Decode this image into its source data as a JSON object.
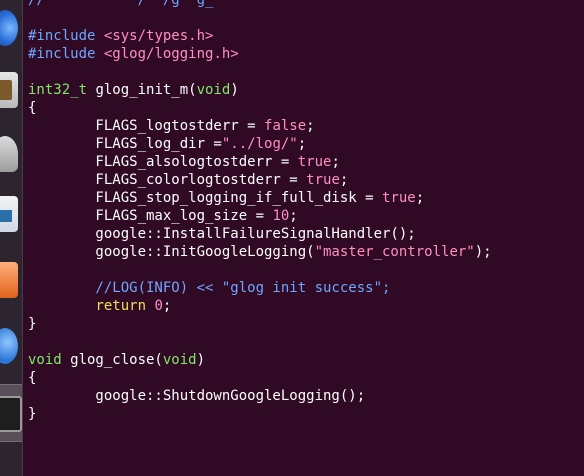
{
  "editor": {
    "lines": [
      [
        {
          "t": "// ",
          "c": "cm"
        },
        {
          "t": "          /  /g  g_",
          "c": "cm"
        }
      ],
      [],
      [
        {
          "t": "#include",
          "c": "pp"
        },
        {
          "t": " ",
          "c": "br"
        },
        {
          "t": "<sys/types.h>",
          "c": "inc"
        }
      ],
      [
        {
          "t": "#include",
          "c": "pp"
        },
        {
          "t": " ",
          "c": "br"
        },
        {
          "t": "<glog/logging.h>",
          "c": "inc"
        }
      ],
      [],
      [
        {
          "t": "int32_t",
          "c": "ty"
        },
        {
          "t": " glog_init_m(",
          "c": "br"
        },
        {
          "t": "void",
          "c": "ty"
        },
        {
          "t": ")",
          "c": "br"
        }
      ],
      [
        {
          "t": "{",
          "c": "br"
        }
      ],
      [
        {
          "t": "        FLAGS_logtostderr = ",
          "c": "br"
        },
        {
          "t": "false",
          "c": "num"
        },
        {
          "t": ";",
          "c": "br"
        }
      ],
      [
        {
          "t": "        FLAGS_log_dir =",
          "c": "br"
        },
        {
          "t": "\"../log/\"",
          "c": "str"
        },
        {
          "t": ";",
          "c": "br"
        }
      ],
      [
        {
          "t": "        FLAGS_alsologtostderr = ",
          "c": "br"
        },
        {
          "t": "true",
          "c": "num"
        },
        {
          "t": ";",
          "c": "br"
        }
      ],
      [
        {
          "t": "        FLAGS_colorlogtostderr = ",
          "c": "br"
        },
        {
          "t": "true",
          "c": "num"
        },
        {
          "t": ";",
          "c": "br"
        }
      ],
      [
        {
          "t": "        FLAGS_stop_logging_if_full_disk = ",
          "c": "br"
        },
        {
          "t": "true",
          "c": "num"
        },
        {
          "t": ";",
          "c": "br"
        }
      ],
      [
        {
          "t": "        FLAGS_max_log_size = ",
          "c": "br"
        },
        {
          "t": "10",
          "c": "num"
        },
        {
          "t": ";",
          "c": "br"
        }
      ],
      [
        {
          "t": "        google::InstallFailureSignalHandler();",
          "c": "br"
        }
      ],
      [
        {
          "t": "        google::InitGoogleLogging(",
          "c": "br"
        },
        {
          "t": "\"master_controller\"",
          "c": "str"
        },
        {
          "t": ");",
          "c": "br"
        }
      ],
      [],
      [
        {
          "t": "        //LOG(INFO) << \"glog init success\";",
          "c": "cm"
        }
      ],
      [
        {
          "t": "        ",
          "c": "br"
        },
        {
          "t": "return",
          "c": "kw"
        },
        {
          "t": " ",
          "c": "br"
        },
        {
          "t": "0",
          "c": "num"
        },
        {
          "t": ";",
          "c": "br"
        }
      ],
      [
        {
          "t": "}",
          "c": "br"
        }
      ],
      [],
      [
        {
          "t": "void",
          "c": "ty"
        },
        {
          "t": " glog_close(",
          "c": "br"
        },
        {
          "t": "void",
          "c": "ty"
        },
        {
          "t": ")",
          "c": "br"
        }
      ],
      [
        {
          "t": "{",
          "c": "br"
        }
      ],
      [
        {
          "t": "        google::ShutdownGoogleLogging();",
          "c": "br"
        }
      ],
      [
        {
          "t": "}",
          "c": "br"
        }
      ]
    ]
  },
  "colors": {
    "background": "#300a24",
    "type": "#7fe86a",
    "preprocessor": "#6fa6ff",
    "string": "#ff8ec4",
    "keyword": "#f2e05a"
  },
  "launcher": {
    "icons": [
      "browser-icon",
      "files-icon",
      "disk-icon",
      "writer-icon",
      "impress-icon",
      "help-icon",
      "terminal-icon"
    ]
  }
}
